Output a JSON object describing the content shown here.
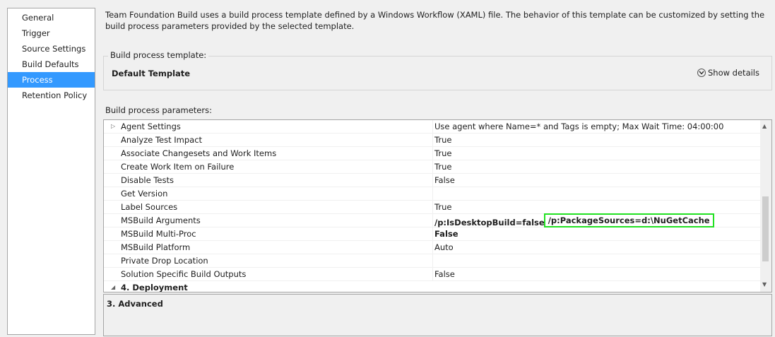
{
  "nav": {
    "items": [
      {
        "label": "General",
        "selected": false
      },
      {
        "label": "Trigger",
        "selected": false
      },
      {
        "label": "Source Settings",
        "selected": false
      },
      {
        "label": "Build Defaults",
        "selected": false
      },
      {
        "label": "Process",
        "selected": true
      },
      {
        "label": "Retention Policy",
        "selected": false
      }
    ]
  },
  "intro_text": "Team Foundation Build uses a build process template defined by a Windows Workflow (XAML) file. The behavior of this template can be customized by setting the build process parameters provided by the selected template.",
  "template_group": {
    "legend": "Build process template:",
    "name": "Default Template",
    "show_details_label": "Show details"
  },
  "params": {
    "label": "Build process parameters:",
    "rows": [
      {
        "name": "Agent Settings",
        "value": "Use agent where Name=* and Tags is empty; Max Wait Time: 04:00:00",
        "expandable": true
      },
      {
        "name": "Analyze Test Impact",
        "value": "True"
      },
      {
        "name": "Associate Changesets and Work Items",
        "value": "True"
      },
      {
        "name": "Create Work Item on Failure",
        "value": "True"
      },
      {
        "name": "Disable Tests",
        "value": "False"
      },
      {
        "name": "Get Version",
        "value": ""
      },
      {
        "name": "Label Sources",
        "value": "True"
      },
      {
        "name": "MSBuild Arguments",
        "value_a": "/p:IsDesktopBuild=false",
        "value_b": "/p:PackageSources=d:\\NuGetCache"
      },
      {
        "name": "MSBuild Multi-Proc",
        "value": "False",
        "bold": true
      },
      {
        "name": "MSBuild Platform",
        "value": "Auto"
      },
      {
        "name": "Private Drop Location",
        "value": ""
      },
      {
        "name": "Solution Specific Build Outputs",
        "value": "False"
      }
    ],
    "section_row": "4. Deployment"
  },
  "description": {
    "title": "3. Advanced"
  },
  "colors": {
    "selection": "#3399ff",
    "highlight": "#22e022"
  }
}
